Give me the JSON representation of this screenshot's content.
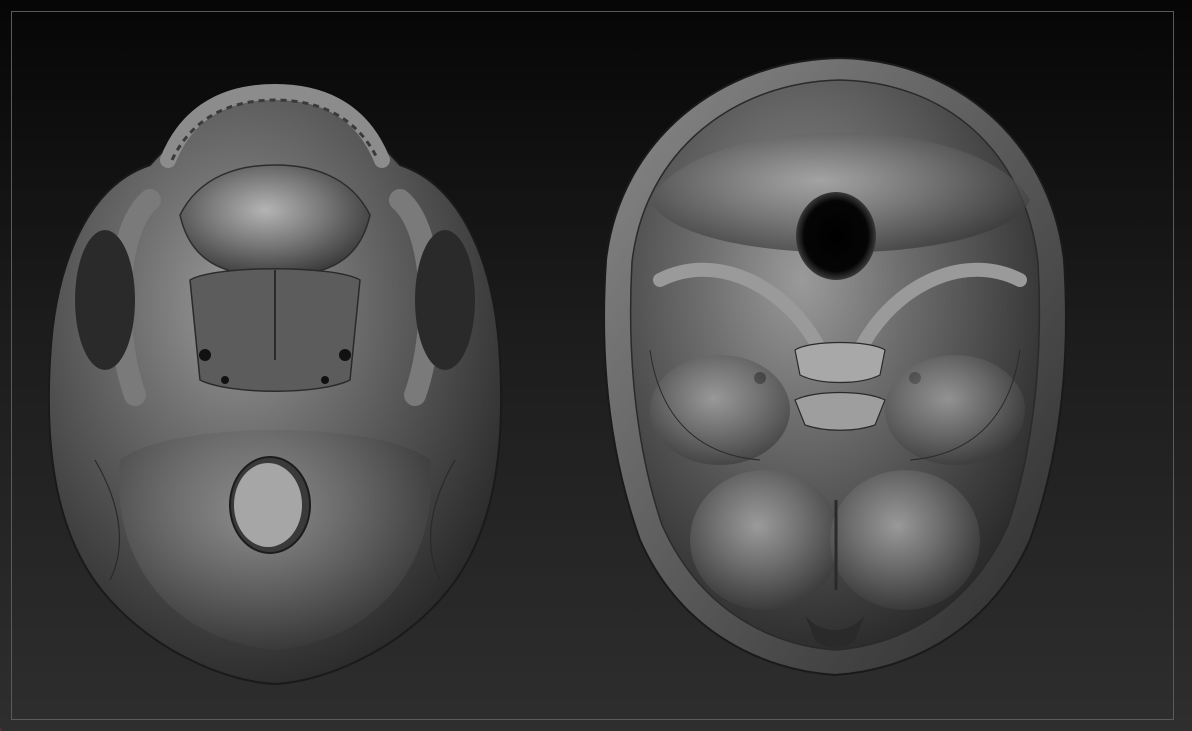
{
  "canvas": {
    "background_top": "#060606",
    "background_bottom": "#2e2e2e",
    "frame_color": "#5a5a5a"
  },
  "models": [
    {
      "id": "skull-inferior-view",
      "material": "matcap-gray"
    },
    {
      "id": "cranial-base-superior-view",
      "material": "matcap-gray"
    }
  ]
}
